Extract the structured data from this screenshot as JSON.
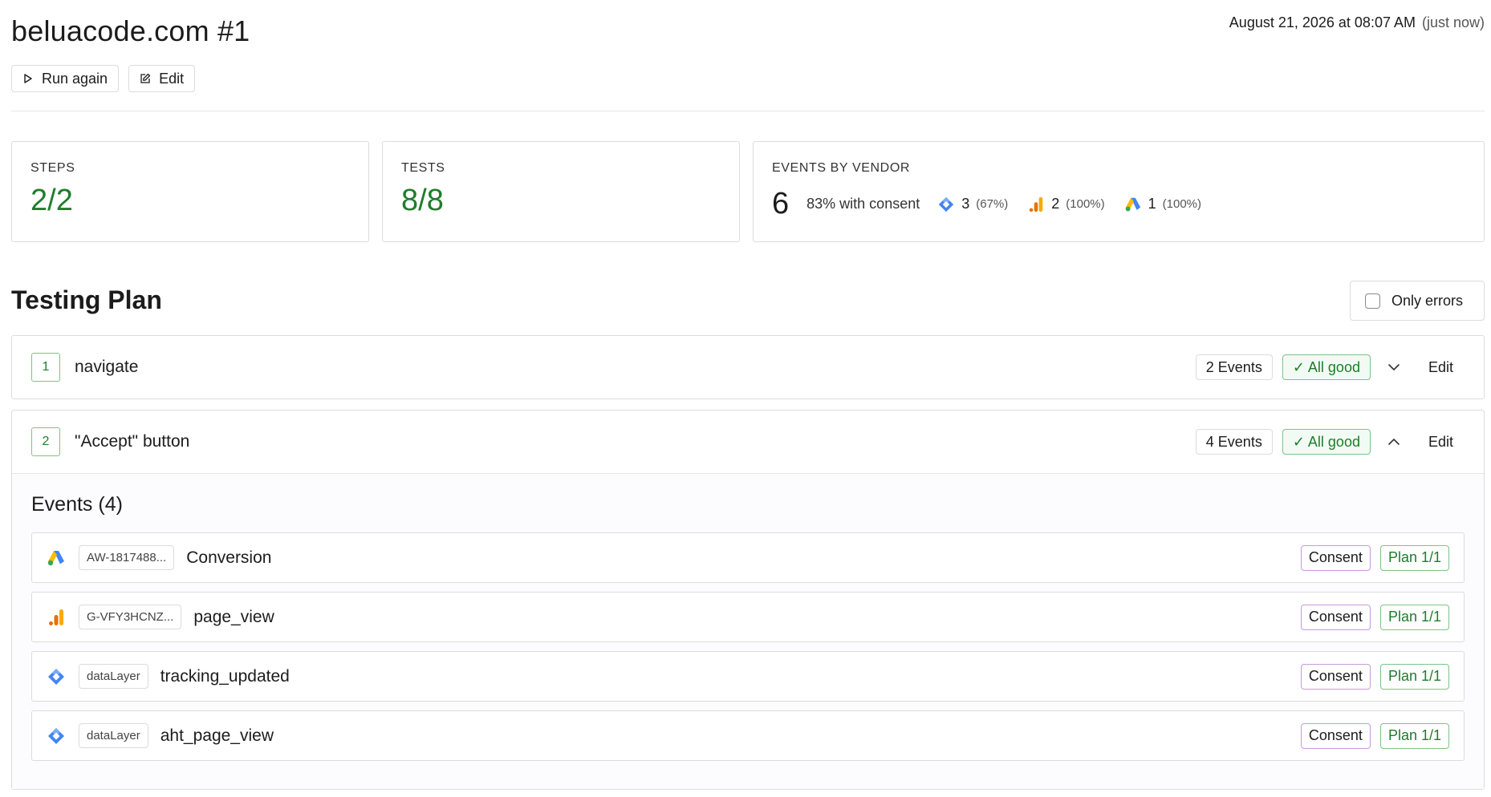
{
  "header": {
    "title": "beluacode.com #1",
    "timestamp": "August 21, 2026 at 08:07 AM",
    "relative_time": "(just now)",
    "run_again_label": "Run again",
    "edit_label": "Edit"
  },
  "stats": {
    "steps": {
      "label": "STEPS",
      "value": "2/2"
    },
    "tests": {
      "label": "TESTS",
      "value": "8/8"
    },
    "events_by_vendor": {
      "label": "EVENTS BY VENDOR",
      "total": "6",
      "consent_text": "83% with consent",
      "vendors": [
        {
          "icon": "gtm-icon",
          "count": "3",
          "percent": "(67%)"
        },
        {
          "icon": "google-analytics-icon",
          "count": "2",
          "percent": "(100%)"
        },
        {
          "icon": "google-ads-icon",
          "count": "1",
          "percent": "(100%)"
        }
      ]
    }
  },
  "plan": {
    "title": "Testing Plan",
    "only_errors_label": "Only errors",
    "only_errors_checked": false,
    "steps": [
      {
        "number": "1",
        "name": "navigate",
        "events": "2 Events",
        "status": "✓ All good",
        "expanded": false,
        "edit_label": "Edit"
      },
      {
        "number": "2",
        "name": "\"Accept\" button",
        "events": "4 Events",
        "status": "✓ All good",
        "expanded": true,
        "edit_label": "Edit"
      }
    ],
    "events_title": "Events (4)",
    "events": [
      {
        "vendor_icon": "google-ads-icon",
        "id": "AW-1817488...",
        "name": "Conversion",
        "consent": "Consent",
        "plan": "Plan 1/1"
      },
      {
        "vendor_icon": "google-analytics-icon",
        "id": "G-VFY3HCNZ...",
        "name": "page_view",
        "consent": "Consent",
        "plan": "Plan 1/1"
      },
      {
        "vendor_icon": "gtm-icon",
        "id": "dataLayer",
        "name": "tracking_updated",
        "consent": "Consent",
        "plan": "Plan 1/1"
      },
      {
        "vendor_icon": "gtm-icon",
        "id": "dataLayer",
        "name": "aht_page_view",
        "consent": "Consent",
        "plan": "Plan 1/1"
      }
    ]
  },
  "colors": {
    "success": "#1e7d2a",
    "success_border": "#7cc389",
    "consent_border": "#c59bd8",
    "border": "#dcdcdc"
  }
}
